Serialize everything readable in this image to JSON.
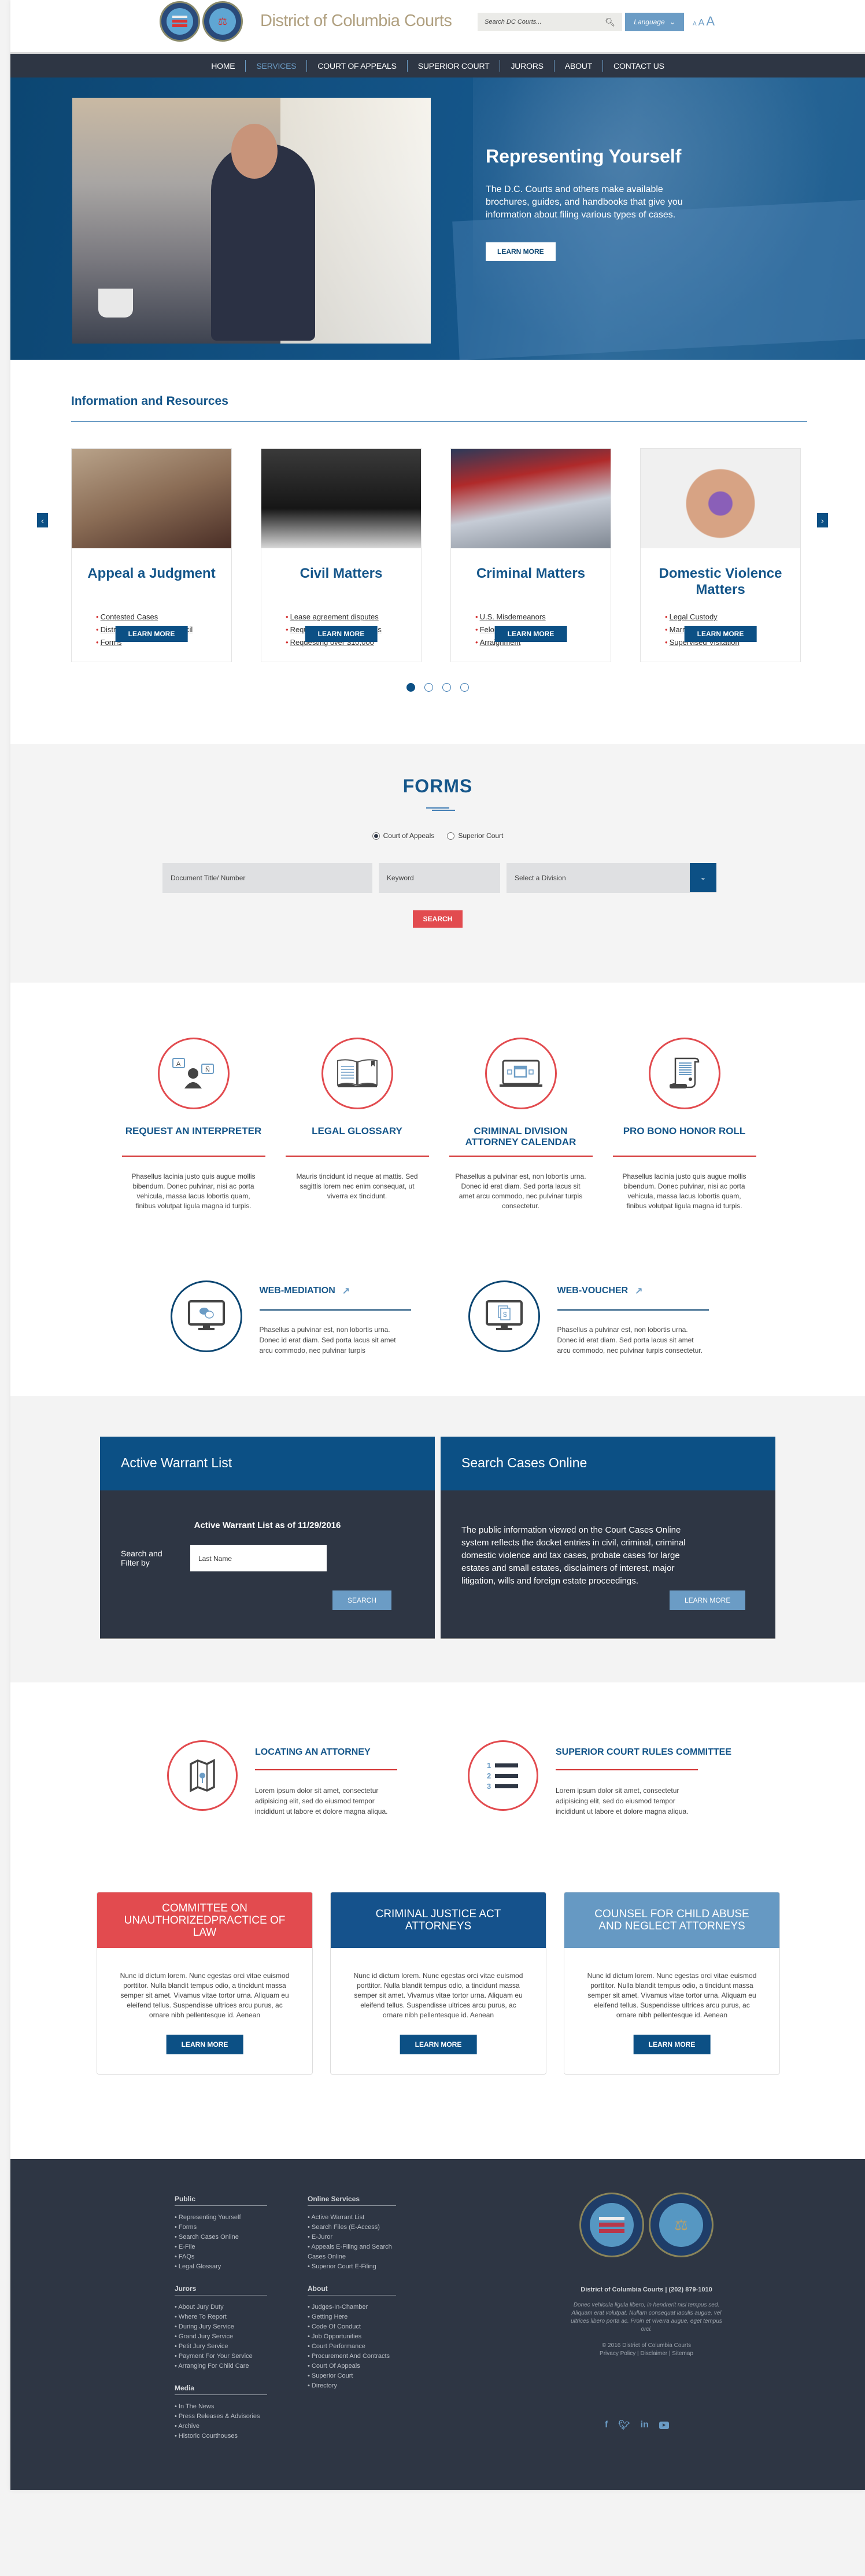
{
  "header": {
    "site_title": "District of Columbia Courts",
    "search_placeholder": "Search DC Courts...",
    "language_label": "Language",
    "font_size_labels": [
      "A",
      "A",
      "A"
    ]
  },
  "nav": {
    "items": [
      {
        "label": "HOME",
        "active": false
      },
      {
        "label": "SERVICES",
        "active": true
      },
      {
        "label": "COURT OF APPEALS",
        "active": false
      },
      {
        "label": "SUPERIOR COURT",
        "active": false
      },
      {
        "label": "JURORS",
        "active": false
      },
      {
        "label": "ABOUT",
        "active": false
      },
      {
        "label": "CONTACT US",
        "active": false
      }
    ]
  },
  "hero": {
    "title": "Representing Yourself",
    "text": "The D.C. Courts and others make available brochures, guides, and handbooks that give you information about filing various types of cases.",
    "button": "LEARN MORE"
  },
  "info": {
    "title": "Information and Resources",
    "cards": [
      {
        "title": "Appeal a Judgment",
        "links": [
          "Contested Cases",
          "District of Columbia Council",
          "Forms"
        ],
        "button": "LEARN MORE"
      },
      {
        "title": "Civil Matters",
        "links": [
          "Lease agreement disputes",
          "Requesting $10,000 or less",
          "Requesting over $10,000"
        ],
        "button": "LEARN MORE"
      },
      {
        "title": "Criminal Matters",
        "links": [
          "U.S. Misdemeanors",
          "Felonies",
          "Arraignment"
        ],
        "button": "LEARN MORE"
      },
      {
        "title": "Domestic Violence Matters",
        "links": [
          "Legal Custody",
          "Marriage",
          "Supervised Visitation"
        ],
        "button": "LEARN MORE"
      }
    ],
    "prev_label": "‹",
    "next_label": "›",
    "pagination": {
      "total": 4,
      "active": 1
    }
  },
  "forms": {
    "title": "FORMS",
    "radios": [
      {
        "label": "Court of Appeals",
        "checked": true
      },
      {
        "label": "Superior Court",
        "checked": false
      }
    ],
    "doc_placeholder": "Document Title/ Number",
    "keyword_placeholder": "Keyword",
    "division_placeholder": "Select a Division",
    "search_button": "SEARCH"
  },
  "services": {
    "items": [
      {
        "title": "REQUEST AN INTERPRETER",
        "text": "Phasellus lacinia justo quis augue mollis bibendum. Donec pulvinar, nisi ac porta vehicula, massa lacus lobortis quam, finibus volutpat ligula magna id turpis."
      },
      {
        "title": "LEGAL GLOSSARY",
        "text": "Mauris tincidunt id neque at mattis. Sed sagittis lorem nec enim consequat, ut viverra ex tincidunt."
      },
      {
        "title": "CRIMINAL DIVISION ATTORNEY  CALENDAR",
        "text": "Phasellus a pulvinar est, non lobortis urna. Donec id erat diam. Sed porta lacus sit amet arcu commodo, nec pulvinar turpis consectetur."
      },
      {
        "title": "PRO BONO HONOR ROLL",
        "text": "Phasellus lacinia justo quis augue mollis bibendum. Donec pulvinar, nisi ac porta vehicula, massa lacus lobortis quam, finibus volutpat ligula magna id turpis."
      }
    ],
    "web": [
      {
        "title": "WEB-MEDIATION",
        "text": "Phasellus a pulvinar est, non lobortis urna. Donec id erat diam. Sed porta lacus sit amet arcu commodo, nec pulvinar turpis"
      },
      {
        "title": "WEB-VOUCHER",
        "text": "Phasellus a pulvinar est, non lobortis urna. Donec id erat diam. Sed porta lacus sit amet arcu commodo, nec pulvinar turpis consectetur."
      }
    ]
  },
  "warrant": {
    "title": "Active Warrant List",
    "subtitle": "Active Warrant List as of 11/29/2016",
    "filter_label": "Search and Filter by",
    "input_placeholder": "Last Name",
    "button": "SEARCH"
  },
  "cases": {
    "title": "Search Cases Online",
    "text": "The public information viewed on the Court Cases Online system reflects the docket entries in civil, criminal, criminal domestic violence and tax cases, probate cases for large estates and small estates, disclaimers of interest, major litigation, wills and foreign estate proceedings.",
    "button": "LEARN MORE"
  },
  "attorney": {
    "items": [
      {
        "title": "LOCATING AN ATTORNEY",
        "text": "Lorem ipsum dolor sit amet, consectetur adipisicing elit, sed do eiusmod tempor incididunt ut labore et dolore magna aliqua."
      },
      {
        "title": "SUPERIOR COURT RULES COMMITTEE",
        "text": "Lorem ipsum dolor sit amet, consectetur adipisicing elit, sed do eiusmod tempor incididunt ut labore et dolore magna aliqua."
      }
    ]
  },
  "committees": {
    "items": [
      {
        "title": "COMMITTEE ON UNAUTHORIZEDPRACTICE OF LAW",
        "color": "#e24b4f",
        "text": "Nunc id dictum lorem. Nunc egestas orci vitae euismod porttitor. Nulla blandit tempus odio, a tincidunt massa semper sit amet. Vivamus vitae tortor urna. Aliquam eu eleifend tellus. Suspendisse ultrices arcu purus, ac ornare nibh pellentesque id. Aenean",
        "button": "LEARN MORE"
      },
      {
        "title": "CRIMINAL JUSTICE ACT ATTORNEYS",
        "color": "#15528c",
        "text": "Nunc id dictum lorem. Nunc egestas orci vitae euismod porttitor. Nulla blandit tempus odio, a tincidunt massa semper sit amet. Vivamus vitae tortor urna. Aliquam eu eleifend tellus. Suspendisse ultrices arcu purus, ac ornare nibh pellentesque id. Aenean",
        "button": "LEARN MORE"
      },
      {
        "title": "COUNSEL FOR CHILD ABUSE AND NEGLECT ATTORNEYS",
        "color": "#6699c3",
        "text": "Nunc id dictum lorem. Nunc egestas orci vitae euismod porttitor. Nulla blandit tempus odio, a tincidunt massa semper sit amet. Vivamus vitae tortor urna. Aliquam eu eleifend tellus. Suspendisse ultrices arcu purus, ac ornare nibh pellentesque id. Aenean",
        "button": "LEARN MORE"
      }
    ]
  },
  "footer": {
    "col1": [
      {
        "heading": "Public",
        "links": [
          "Representing Yourself",
          "Forms",
          "Search Cases Online",
          "E-File",
          "FAQs",
          "Legal Glossary"
        ]
      },
      {
        "heading": "Jurors",
        "links": [
          "About Jury Duty",
          "Where To Report",
          "During Jury Service",
          "Grand Jury Service",
          "Petit Jury Service",
          "Payment For Your Service",
          "Arranging For Child Care"
        ]
      },
      {
        "heading": "Media",
        "links": [
          "In The News",
          "Press Releases & Advisories",
          "Archive",
          "Historic Courthouses"
        ]
      }
    ],
    "col2": [
      {
        "heading": "Online Services",
        "links": [
          "Active Warrant List",
          "Search Files (E-Access)",
          "E-Juror",
          "Appeals E-Filing and Search Cases Online",
          "Superior Court E-Filing"
        ]
      },
      {
        "heading": "About",
        "links": [
          "Judges-In-Chamber",
          "Getting Here",
          "Code Of Conduct",
          "Job Opportunities",
          "Court Performance",
          "Procurement And Contracts",
          "Court Of Appeals",
          "Superior Court",
          "Directory"
        ]
      }
    ],
    "contact": "District of Columbia Courts | (202) 879-1010",
    "blurb": "Donec vehicula ligula libero, in hendrerit nisl tempus sed. Aliquam erat volutpat. Nullam consequat iaculis augue, vel ultrices libero porta ac. Proin et viverra augue, eget tempus orci.",
    "copyright": "© 2016 District of Columbia Courts",
    "legal_links": "Privacy Policy | Disclaimer | Sitemap",
    "social": [
      "facebook-icon",
      "twitter-icon",
      "linkedin-icon",
      "youtube-icon"
    ]
  },
  "colors": {
    "primary": "#0c5085",
    "accent_red": "#e24b4f",
    "light_blue": "#6b9cc5",
    "dark_navy": "#2e3644"
  }
}
